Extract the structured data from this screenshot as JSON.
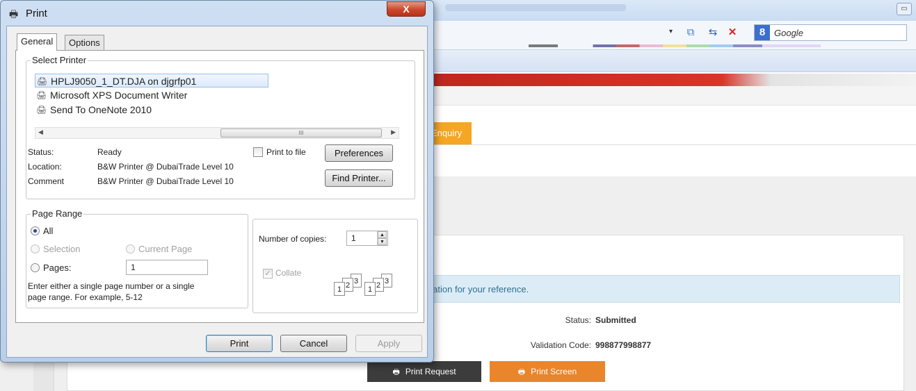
{
  "browser": {
    "search_placeholder": "Google",
    "google_logo_letter": "8",
    "dropdown_arrow": "▾",
    "restore_glyph": "▭",
    "icons": [
      "rss-icon",
      "refresh-icon",
      "stop-icon"
    ]
  },
  "page": {
    "tab_enquiry": "Enquiry",
    "info_message": "rmation for your reference.",
    "status_label": "Status:",
    "status_value": "Submitted",
    "validation_label": "Validation Code:",
    "validation_value": "998877998877",
    "print_request_label": "Print Request",
    "print_screen_label": "Print Screen",
    "accent_orange": "#e9852b",
    "dark_button": "#3c3c3c"
  },
  "dialog": {
    "title": "Print",
    "close_glyph": "X",
    "tabs": [
      "General",
      "Options"
    ],
    "select_printer": {
      "title": "Select Printer",
      "printers": [
        "HPLJ9050_1_DT.DJA on djgrfp01",
        "Microsoft XPS Document Writer",
        "Send To OneNote 2010"
      ],
      "selected_index": 0,
      "status_label": "Status:",
      "status_value": "Ready",
      "location_label": "Location:",
      "location_value": "B&W Printer @ DubaiTrade Level 10",
      "comment_label": "Comment",
      "comment_value": "B&W Printer @ DubaiTrade Level 10",
      "print_to_file_label": "Print to file",
      "preferences_label": "Preferences",
      "find_printer_label": "Find Printer...",
      "scroll_thumb_glyph": "III"
    },
    "page_range": {
      "title": "Page Range",
      "all_label": "All",
      "selection_label": "Selection",
      "current_page_label": "Current Page",
      "pages_label": "Pages:",
      "pages_value": "1",
      "help_line1": "Enter either a single page number or a single",
      "help_line2": "page range.  For example, 5-12",
      "selected_option": "All"
    },
    "copies": {
      "number_label": "Number of copies:",
      "number_value": "1",
      "collate_label": "Collate",
      "collate_checked": true,
      "collate_pages": [
        "1",
        "2",
        "3"
      ]
    },
    "buttons": {
      "print": "Print",
      "cancel": "Cancel",
      "apply": "Apply"
    }
  }
}
